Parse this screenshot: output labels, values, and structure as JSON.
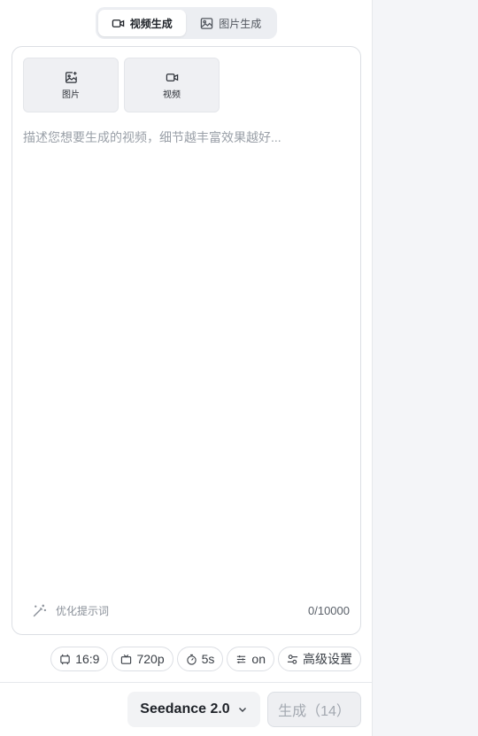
{
  "mode_tabs": [
    {
      "label": "视频生成",
      "icon": "video-camera-icon",
      "active": true
    },
    {
      "label": "图片生成",
      "icon": "image-icon",
      "active": false
    }
  ],
  "upload": {
    "image_label": "图片",
    "video_label": "视频"
  },
  "prompt": {
    "value": "",
    "placeholder": "描述您想要生成的视频，细节越丰富效果越好..."
  },
  "optimize_label": "优化提示词",
  "char_count": "0/10000",
  "settings": {
    "aspect_ratio": "16:9",
    "resolution": "720p",
    "duration": "5s",
    "audio": "on",
    "advanced_label": "高级设置"
  },
  "model": {
    "selected": "Seedance 2.0"
  },
  "generate_label": "生成（14）",
  "colors": {
    "background": "#ffffff",
    "right_pane": "#f4f5f8",
    "disabled_text": "#a3a8b0"
  }
}
